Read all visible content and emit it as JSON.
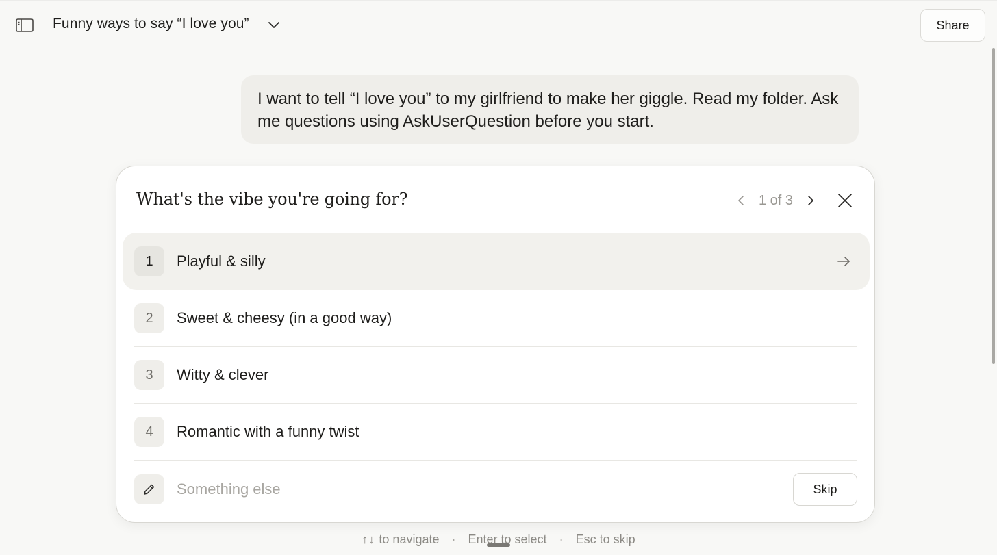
{
  "header": {
    "title": "Funny ways to say “I love you”",
    "share_label": "Share",
    "icons": [
      "sidebar-toggle-icon",
      "chevron-down-icon"
    ]
  },
  "message": {
    "user_text": "I want to tell “I love you” to my girlfriend to make her giggle. Read my folder. Ask me questions using AskUserQuestion before you start."
  },
  "question": {
    "title": "What's the vibe you're going for?",
    "pager_text": "1 of 3",
    "options": [
      {
        "number": "1",
        "label": "Playful & silly",
        "selected": true
      },
      {
        "number": "2",
        "label": "Sweet & cheesy (in a good way)"
      },
      {
        "number": "3",
        "label": "Witty & clever"
      },
      {
        "number": "4",
        "label": "Romantic with a funny twist"
      }
    ],
    "other_placeholder": "Something else",
    "skip_label": "Skip"
  },
  "hints": {
    "navigate": "to navigate",
    "navigate_arrows": "↑↓",
    "select": "Enter to select",
    "skip": "Esc to skip",
    "separator": "·"
  },
  "colors": {
    "background": "#f8f8f6",
    "bubble": "#efeeea",
    "selected_row": "#f2f1ed",
    "text": "#1f1e1c",
    "muted": "#8c8a85"
  }
}
